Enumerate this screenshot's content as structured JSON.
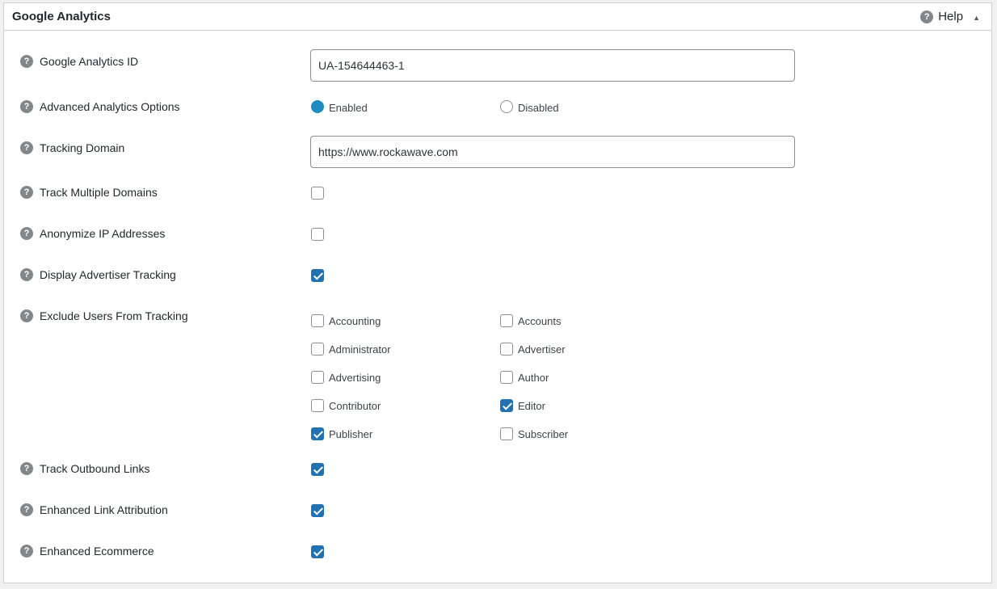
{
  "panel": {
    "title": "Google Analytics",
    "help_label": "Help",
    "toggle_arrow": "▲"
  },
  "icons": {
    "help_glyph": "?"
  },
  "fields": {
    "ga_id": {
      "label": "Google Analytics ID",
      "value": "UA-154644463-1"
    },
    "advanced": {
      "label": "Advanced Analytics Options",
      "options": [
        {
          "label": "Enabled",
          "selected": true
        },
        {
          "label": "Disabled",
          "selected": false
        }
      ]
    },
    "tracking_domain": {
      "label": "Tracking Domain",
      "value": "https://www.rockawave.com"
    },
    "track_multiple_domains": {
      "label": "Track Multiple Domains",
      "checked": false
    },
    "anonymize_ip": {
      "label": "Anonymize IP Addresses",
      "checked": false
    },
    "display_advertiser": {
      "label": "Display Advertiser Tracking",
      "checked": true
    },
    "exclude_users": {
      "label": "Exclude Users From Tracking",
      "roles": [
        {
          "label": "Accounting",
          "checked": false
        },
        {
          "label": "Accounts",
          "checked": false
        },
        {
          "label": "Administrator",
          "checked": false
        },
        {
          "label": "Advertiser",
          "checked": false
        },
        {
          "label": "Advertising",
          "checked": false
        },
        {
          "label": "Author",
          "checked": false
        },
        {
          "label": "Contributor",
          "checked": false
        },
        {
          "label": "Editor",
          "checked": true
        },
        {
          "label": "Publisher",
          "checked": true
        },
        {
          "label": "Subscriber",
          "checked": false
        }
      ]
    },
    "track_outbound": {
      "label": "Track Outbound Links",
      "checked": true
    },
    "enhanced_link": {
      "label": "Enhanced Link Attribution",
      "checked": true
    },
    "enhanced_ecommerce": {
      "label": "Enhanced Ecommerce",
      "checked": true
    }
  },
  "colors": {
    "accent": "#2271b1",
    "radio_selected": "#1e8cbe",
    "help_icon": "#82878c",
    "border": "#ccd0d4"
  }
}
